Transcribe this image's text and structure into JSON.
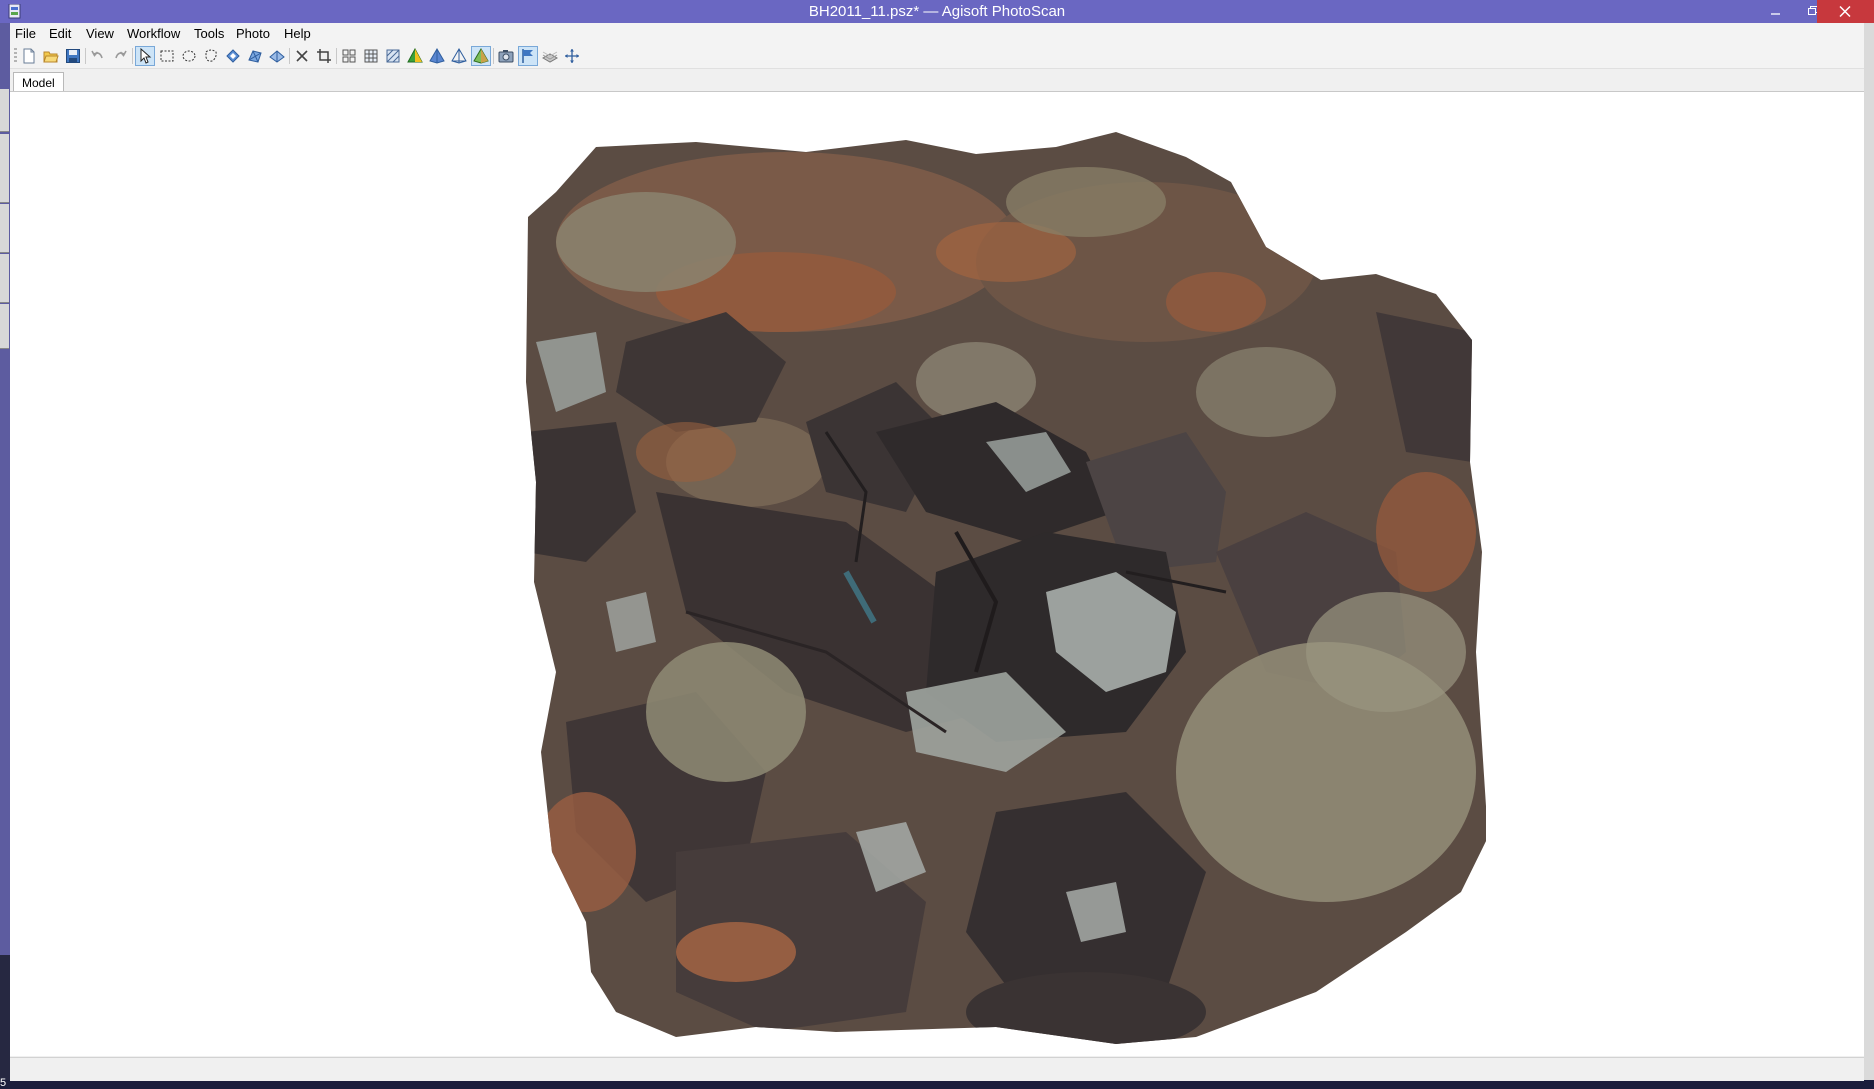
{
  "window": {
    "title": "BH2011_11.psz* — Agisoft PhotoScan",
    "app_icon": "photoscan-app-icon",
    "controls": [
      "minimize-icon",
      "restore-icon",
      "close-icon"
    ]
  },
  "menu": {
    "items": [
      "File",
      "Edit",
      "View",
      "Workflow",
      "Tools",
      "Photo",
      "Help"
    ]
  },
  "toolbar": {
    "tools": [
      {
        "icon": "new-document-icon",
        "active": false
      },
      {
        "icon": "open-folder-icon",
        "active": false
      },
      {
        "icon": "save-icon",
        "active": false
      },
      {
        "icon": "undo-icon",
        "active": false
      },
      {
        "icon": "redo-icon",
        "active": false
      },
      {
        "icon": "navigation-arrow-icon",
        "active": true
      },
      {
        "icon": "rectangle-selection-icon",
        "active": false
      },
      {
        "icon": "circle-selection-icon",
        "active": false
      },
      {
        "icon": "free-form-selection-icon",
        "active": false
      },
      {
        "icon": "gradual-selection-icon",
        "active": false
      },
      {
        "icon": "select-faces-icon",
        "active": false
      },
      {
        "icon": "invert-selection-icon",
        "active": false
      },
      {
        "icon": "delete-selection-icon",
        "active": false
      },
      {
        "icon": "crop-selection-icon",
        "active": false
      },
      {
        "icon": "point-cloud-icon",
        "active": false
      },
      {
        "icon": "dense-cloud-icon",
        "active": false
      },
      {
        "icon": "wireframe-icon",
        "active": false
      },
      {
        "icon": "shaded-model-icon",
        "active": false
      },
      {
        "icon": "solid-model-icon",
        "active": false
      },
      {
        "icon": "wireframe-model-icon",
        "active": false
      },
      {
        "icon": "textured-model-icon",
        "active": true
      },
      {
        "icon": "show-cameras-icon",
        "active": false
      },
      {
        "icon": "show-markers-icon",
        "active": true
      },
      {
        "icon": "show-region-icon",
        "active": false
      },
      {
        "icon": "reset-view-icon",
        "active": false
      }
    ]
  },
  "tabs": [
    {
      "label": "Model",
      "active": true
    }
  ],
  "status": {
    "left_digit": "5"
  },
  "colors": {
    "titlebar": "#6a67c2",
    "close_button": "#c7383d",
    "toolbar_active": "#cde4f7",
    "viewport": "#ffffff"
  }
}
